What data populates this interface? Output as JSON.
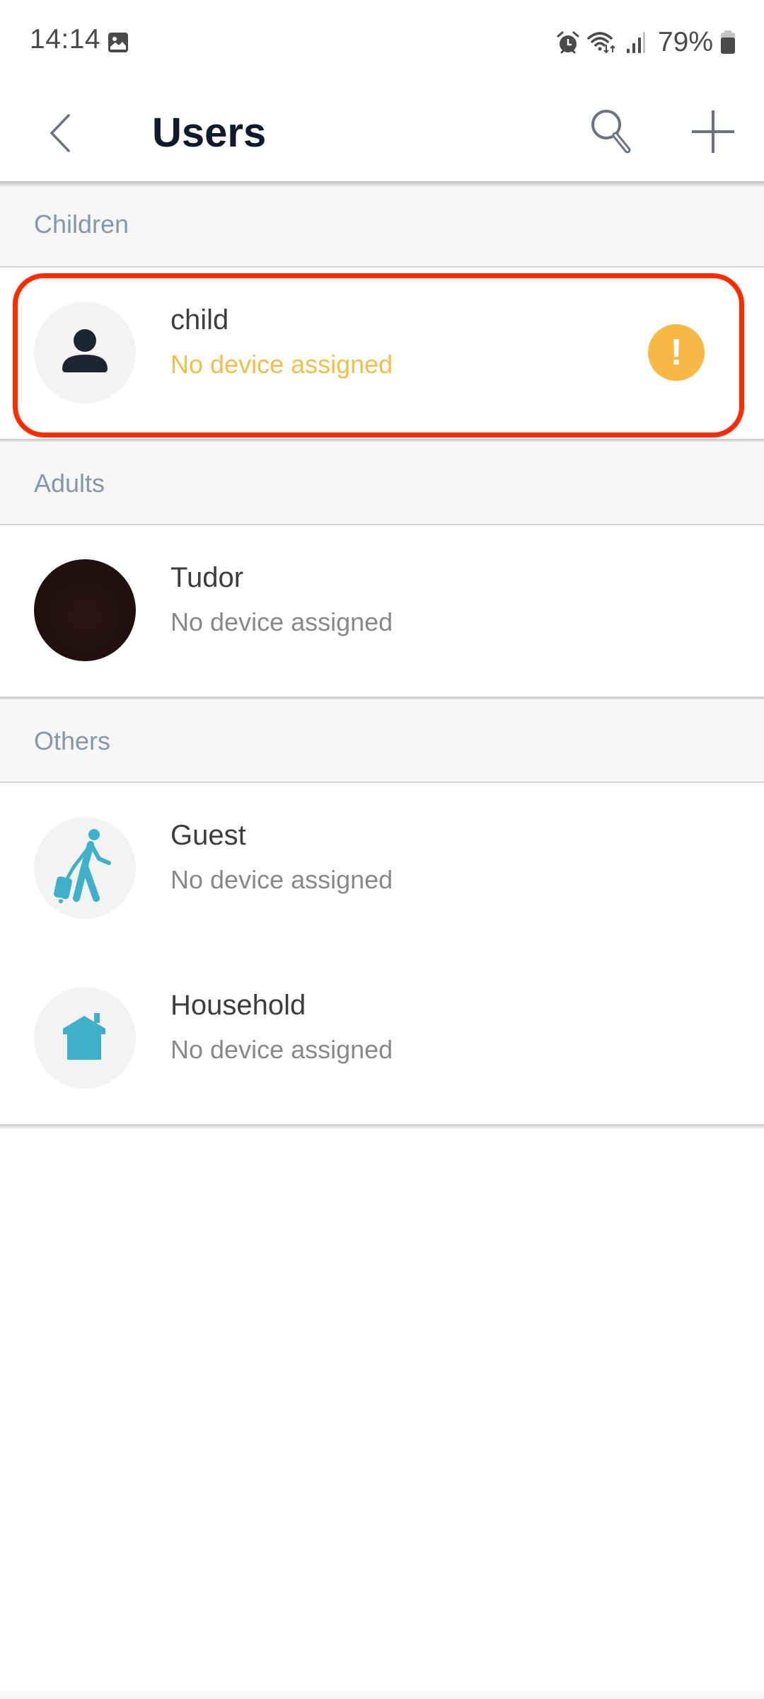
{
  "status_bar": {
    "time": "14:14",
    "notification_icon": "gallery-icon",
    "icons": [
      "alarm-icon",
      "wifi-icon",
      "signal-icon"
    ],
    "battery_percent": "79%",
    "battery_level": 0.79
  },
  "header": {
    "back_icon": "chevron-left-icon",
    "title": "Users",
    "search_icon": "search-icon",
    "add_icon": "plus-icon"
  },
  "sections": [
    {
      "title": "Children",
      "users": [
        {
          "name": "child",
          "status": "No device assigned",
          "avatar": "person-icon",
          "warning": "!",
          "highlighted": true
        }
      ]
    },
    {
      "title": "Adults",
      "users": [
        {
          "name": "Tudor",
          "status": "No device assigned",
          "avatar": "profile-photo"
        }
      ]
    },
    {
      "title": "Others",
      "users": [
        {
          "name": "Guest",
          "status": "No device assigned",
          "avatar": "traveler-icon"
        },
        {
          "name": "Household",
          "status": "No device assigned",
          "avatar": "house-icon"
        }
      ]
    }
  ],
  "colors": {
    "accent_icon": "#3fb0c9",
    "warning": "#f8b944",
    "warning_text": "#f2bd4a",
    "highlight_border": "#ff2a00",
    "section_text": "#8597ab",
    "title_text": "#0f1b2d"
  }
}
